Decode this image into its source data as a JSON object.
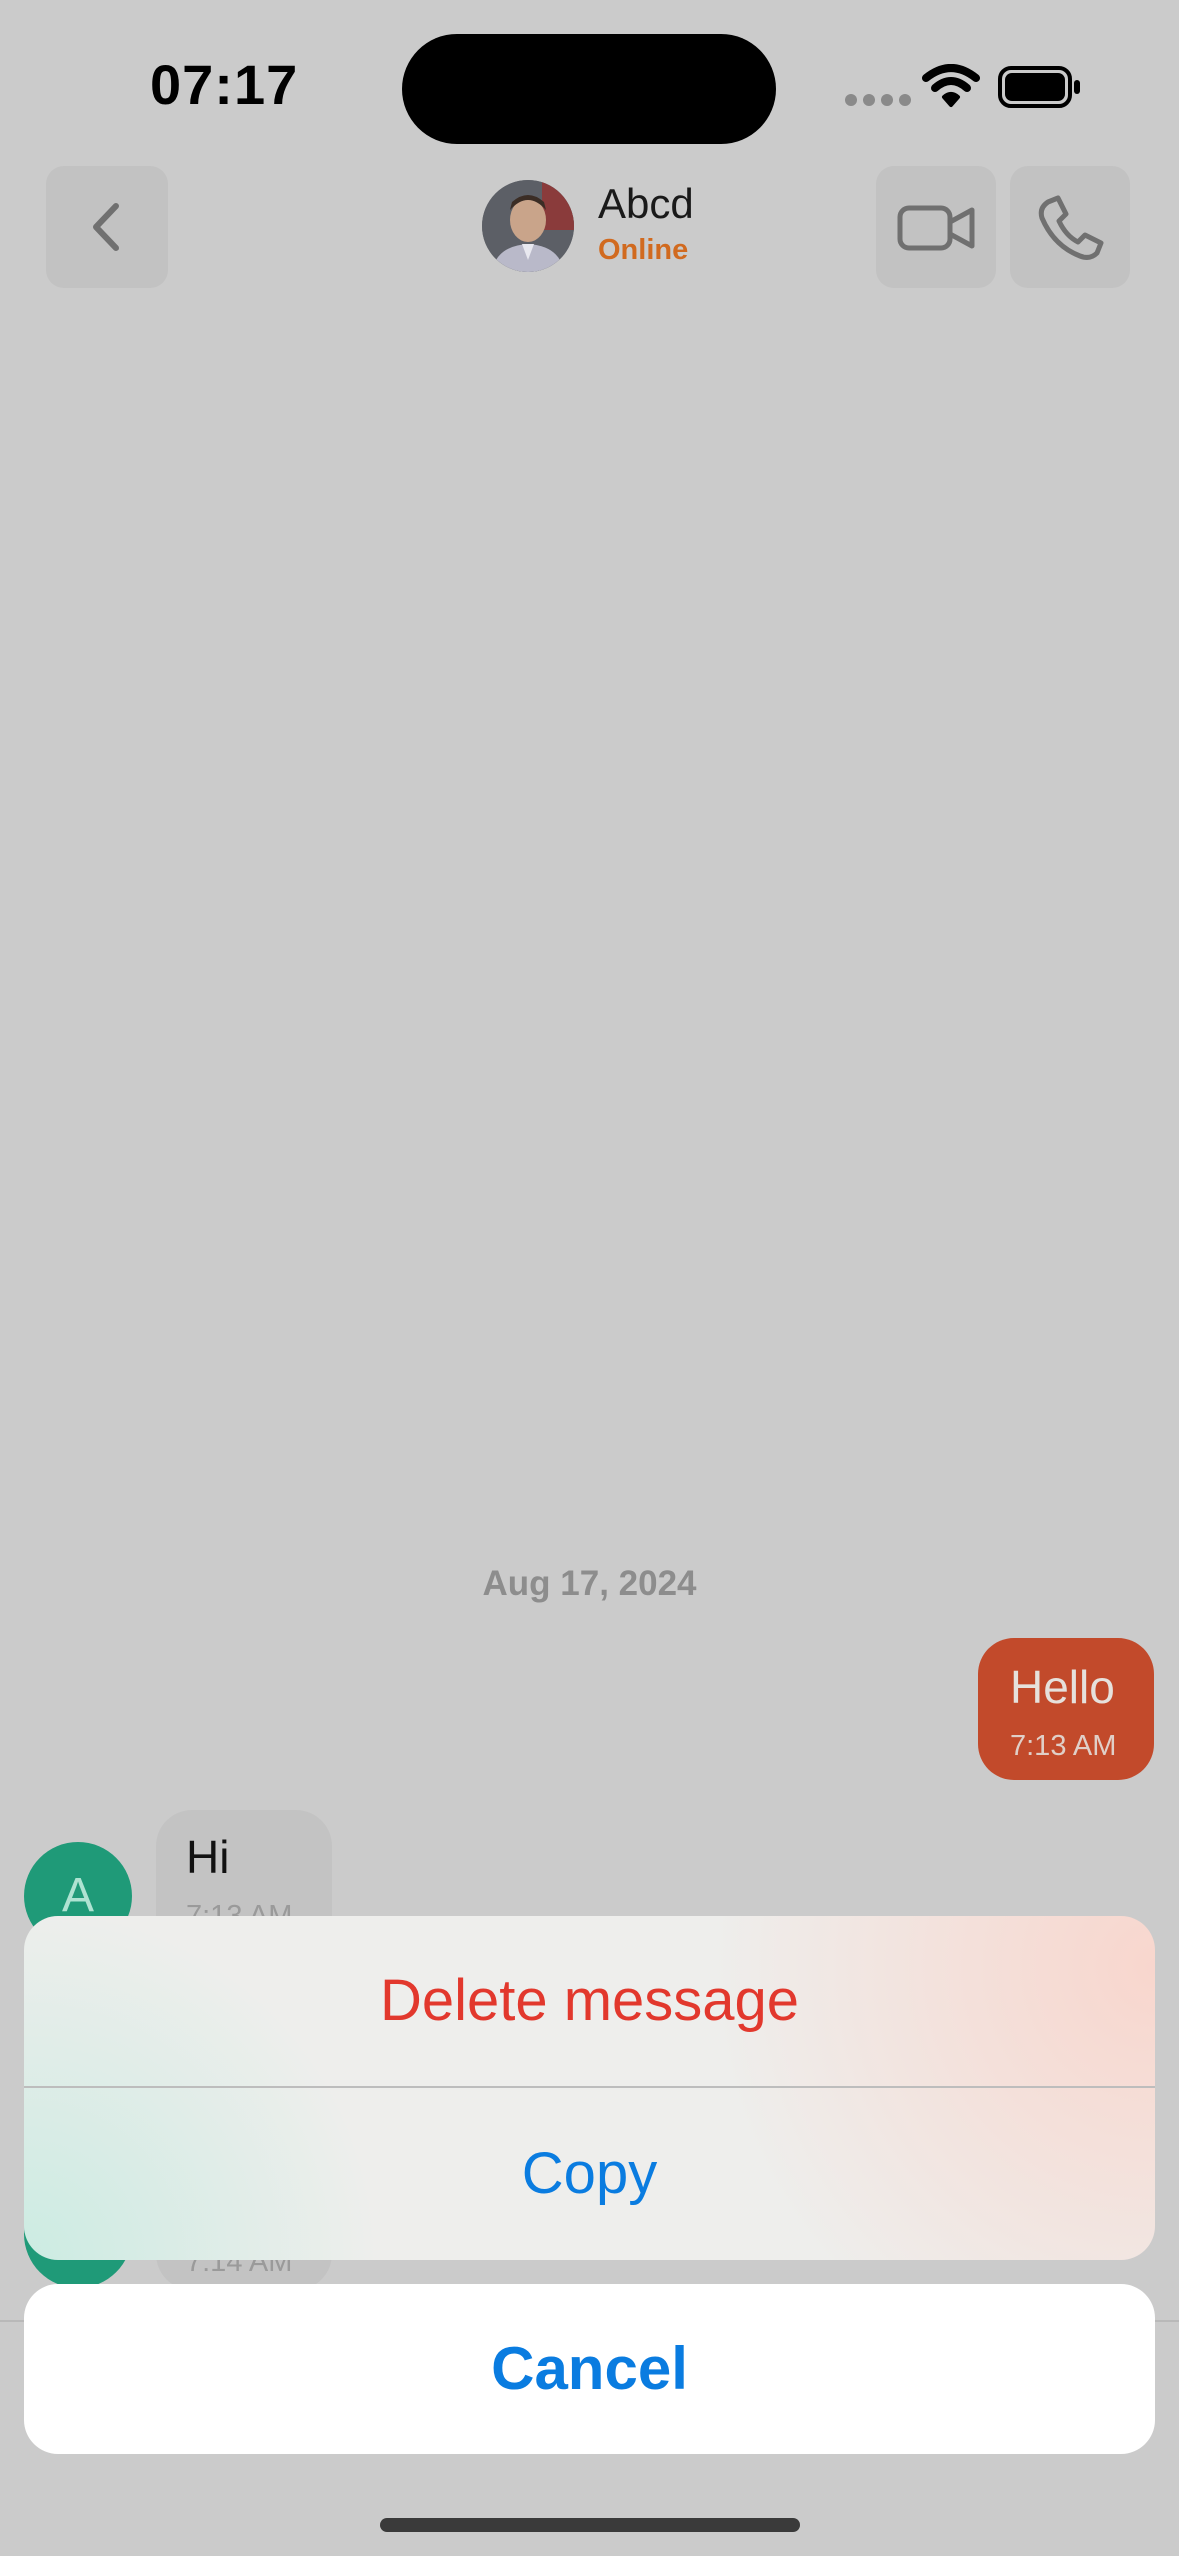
{
  "status_bar": {
    "time": "07:17"
  },
  "header": {
    "contact_name": "Abcd",
    "contact_status": "Online",
    "back_icon": "chevron-left-icon",
    "video_icon": "video-camera-icon",
    "phone_icon": "phone-icon"
  },
  "chat": {
    "date_separator": "Aug 17, 2024",
    "messages": [
      {
        "direction": "outgoing",
        "text": "Hello",
        "time": "7:13 AM"
      },
      {
        "direction": "incoming",
        "avatar_initial": "A",
        "text": "Hi",
        "time": "7:13 AM"
      },
      {
        "direction": "incoming",
        "avatar_initial": "A",
        "text": "",
        "time": "7:14 AM"
      }
    ]
  },
  "action_sheet": {
    "items": [
      {
        "label": "Delete message",
        "style": "destructive"
      },
      {
        "label": "Copy",
        "style": "default"
      }
    ],
    "cancel_label": "Cancel"
  },
  "colors": {
    "accent_blue": "#0a7ce0",
    "destructive_red": "#e2382d",
    "outgoing_bubble": "#c24a2b",
    "status_online": "#d16a1f",
    "avatar_green": "#1f9a78"
  }
}
